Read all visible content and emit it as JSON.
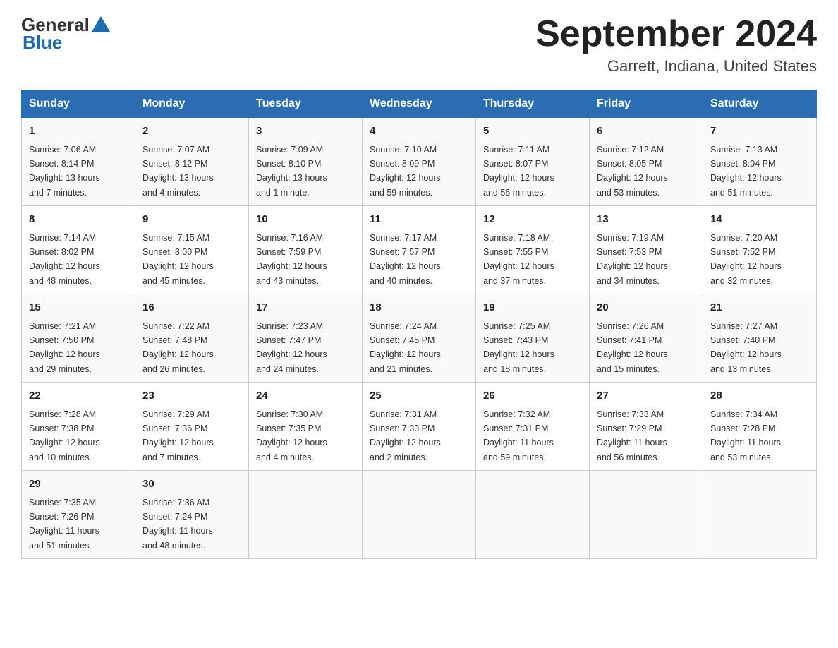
{
  "header": {
    "logo_general": "General",
    "logo_blue": "Blue",
    "month_title": "September 2024",
    "location": "Garrett, Indiana, United States"
  },
  "days_of_week": [
    "Sunday",
    "Monday",
    "Tuesday",
    "Wednesday",
    "Thursday",
    "Friday",
    "Saturday"
  ],
  "weeks": [
    [
      {
        "day": "1",
        "info": "Sunrise: 7:06 AM\nSunset: 8:14 PM\nDaylight: 13 hours\nand 7 minutes."
      },
      {
        "day": "2",
        "info": "Sunrise: 7:07 AM\nSunset: 8:12 PM\nDaylight: 13 hours\nand 4 minutes."
      },
      {
        "day": "3",
        "info": "Sunrise: 7:09 AM\nSunset: 8:10 PM\nDaylight: 13 hours\nand 1 minute."
      },
      {
        "day": "4",
        "info": "Sunrise: 7:10 AM\nSunset: 8:09 PM\nDaylight: 12 hours\nand 59 minutes."
      },
      {
        "day": "5",
        "info": "Sunrise: 7:11 AM\nSunset: 8:07 PM\nDaylight: 12 hours\nand 56 minutes."
      },
      {
        "day": "6",
        "info": "Sunrise: 7:12 AM\nSunset: 8:05 PM\nDaylight: 12 hours\nand 53 minutes."
      },
      {
        "day": "7",
        "info": "Sunrise: 7:13 AM\nSunset: 8:04 PM\nDaylight: 12 hours\nand 51 minutes."
      }
    ],
    [
      {
        "day": "8",
        "info": "Sunrise: 7:14 AM\nSunset: 8:02 PM\nDaylight: 12 hours\nand 48 minutes."
      },
      {
        "day": "9",
        "info": "Sunrise: 7:15 AM\nSunset: 8:00 PM\nDaylight: 12 hours\nand 45 minutes."
      },
      {
        "day": "10",
        "info": "Sunrise: 7:16 AM\nSunset: 7:59 PM\nDaylight: 12 hours\nand 43 minutes."
      },
      {
        "day": "11",
        "info": "Sunrise: 7:17 AM\nSunset: 7:57 PM\nDaylight: 12 hours\nand 40 minutes."
      },
      {
        "day": "12",
        "info": "Sunrise: 7:18 AM\nSunset: 7:55 PM\nDaylight: 12 hours\nand 37 minutes."
      },
      {
        "day": "13",
        "info": "Sunrise: 7:19 AM\nSunset: 7:53 PM\nDaylight: 12 hours\nand 34 minutes."
      },
      {
        "day": "14",
        "info": "Sunrise: 7:20 AM\nSunset: 7:52 PM\nDaylight: 12 hours\nand 32 minutes."
      }
    ],
    [
      {
        "day": "15",
        "info": "Sunrise: 7:21 AM\nSunset: 7:50 PM\nDaylight: 12 hours\nand 29 minutes."
      },
      {
        "day": "16",
        "info": "Sunrise: 7:22 AM\nSunset: 7:48 PM\nDaylight: 12 hours\nand 26 minutes."
      },
      {
        "day": "17",
        "info": "Sunrise: 7:23 AM\nSunset: 7:47 PM\nDaylight: 12 hours\nand 24 minutes."
      },
      {
        "day": "18",
        "info": "Sunrise: 7:24 AM\nSunset: 7:45 PM\nDaylight: 12 hours\nand 21 minutes."
      },
      {
        "day": "19",
        "info": "Sunrise: 7:25 AM\nSunset: 7:43 PM\nDaylight: 12 hours\nand 18 minutes."
      },
      {
        "day": "20",
        "info": "Sunrise: 7:26 AM\nSunset: 7:41 PM\nDaylight: 12 hours\nand 15 minutes."
      },
      {
        "day": "21",
        "info": "Sunrise: 7:27 AM\nSunset: 7:40 PM\nDaylight: 12 hours\nand 13 minutes."
      }
    ],
    [
      {
        "day": "22",
        "info": "Sunrise: 7:28 AM\nSunset: 7:38 PM\nDaylight: 12 hours\nand 10 minutes."
      },
      {
        "day": "23",
        "info": "Sunrise: 7:29 AM\nSunset: 7:36 PM\nDaylight: 12 hours\nand 7 minutes."
      },
      {
        "day": "24",
        "info": "Sunrise: 7:30 AM\nSunset: 7:35 PM\nDaylight: 12 hours\nand 4 minutes."
      },
      {
        "day": "25",
        "info": "Sunrise: 7:31 AM\nSunset: 7:33 PM\nDaylight: 12 hours\nand 2 minutes."
      },
      {
        "day": "26",
        "info": "Sunrise: 7:32 AM\nSunset: 7:31 PM\nDaylight: 11 hours\nand 59 minutes."
      },
      {
        "day": "27",
        "info": "Sunrise: 7:33 AM\nSunset: 7:29 PM\nDaylight: 11 hours\nand 56 minutes."
      },
      {
        "day": "28",
        "info": "Sunrise: 7:34 AM\nSunset: 7:28 PM\nDaylight: 11 hours\nand 53 minutes."
      }
    ],
    [
      {
        "day": "29",
        "info": "Sunrise: 7:35 AM\nSunset: 7:26 PM\nDaylight: 11 hours\nand 51 minutes."
      },
      {
        "day": "30",
        "info": "Sunrise: 7:36 AM\nSunset: 7:24 PM\nDaylight: 11 hours\nand 48 minutes."
      },
      {
        "day": "",
        "info": ""
      },
      {
        "day": "",
        "info": ""
      },
      {
        "day": "",
        "info": ""
      },
      {
        "day": "",
        "info": ""
      },
      {
        "day": "",
        "info": ""
      }
    ]
  ]
}
